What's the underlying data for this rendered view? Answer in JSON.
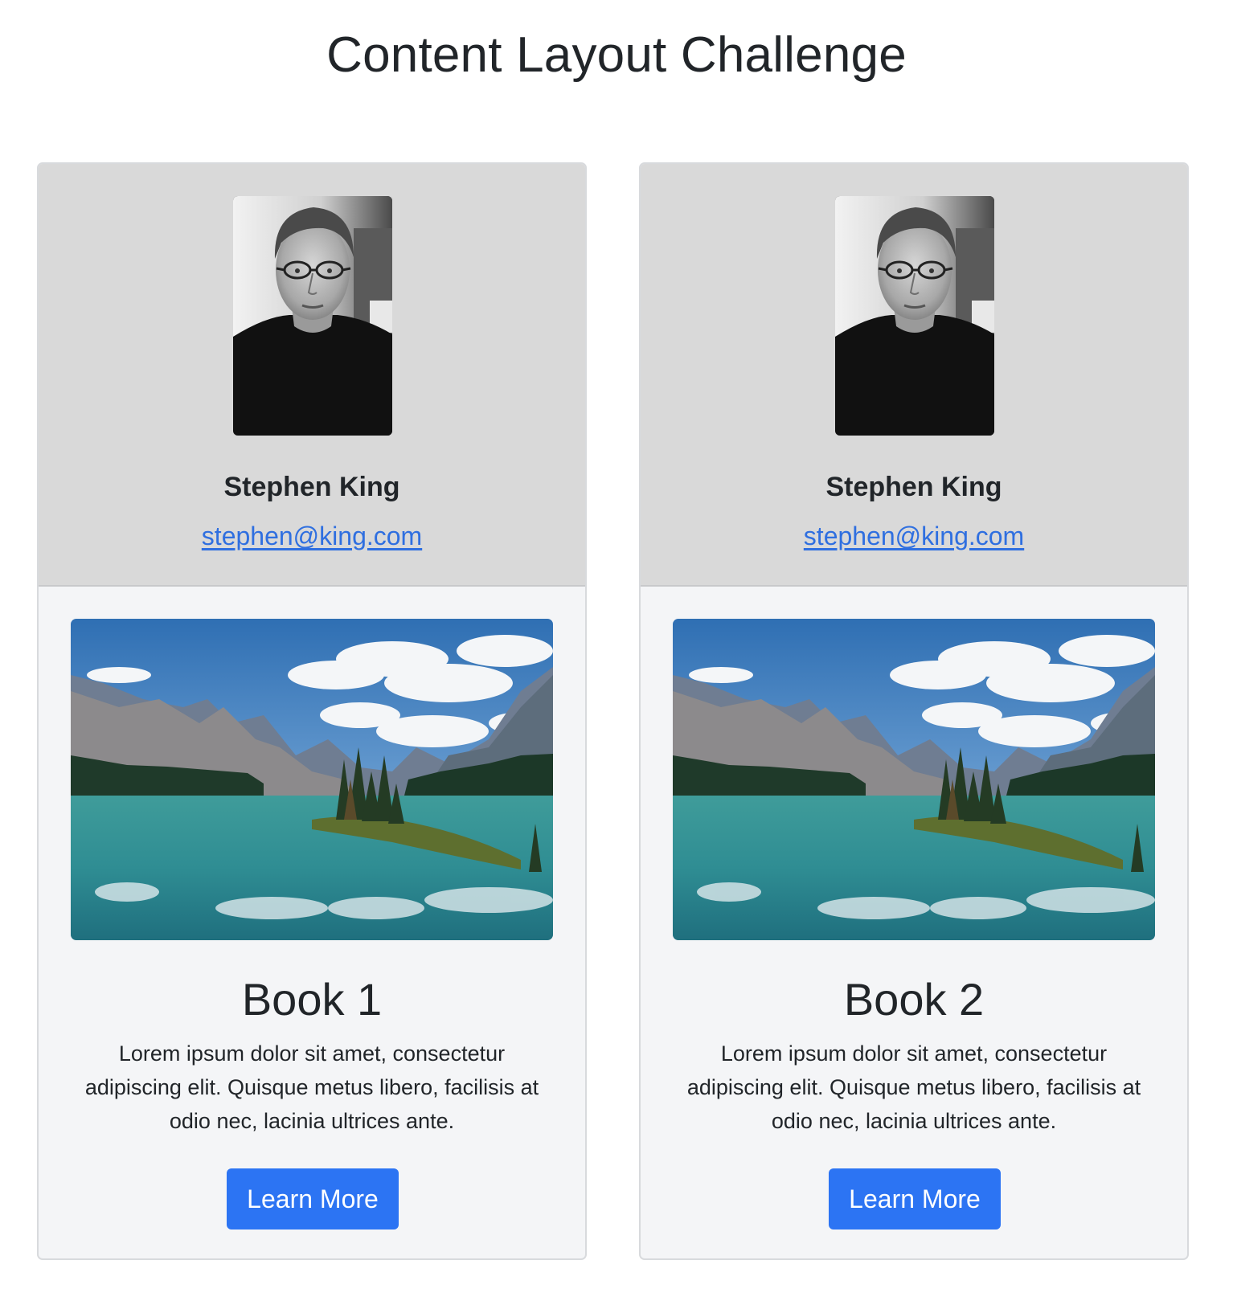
{
  "page": {
    "title": "Content Layout Challenge"
  },
  "cards": [
    {
      "author": {
        "name": "Stephen King",
        "email": "stephen@king.com"
      },
      "book": {
        "title": "Book 1",
        "description": "Lorem ipsum dolor sit amet, consectetur adipiscing elit. Quisque metus libero, facilisis at odio nec, lacinia ultrices ante.",
        "button_label": "Learn More"
      }
    },
    {
      "author": {
        "name": "Stephen King",
        "email": "stephen@king.com"
      },
      "book": {
        "title": "Book 2",
        "description": "Lorem ipsum dolor sit amet, consectetur adipiscing elit. Quisque metus libero, facilisis at odio nec, lacinia ultrices ante.",
        "button_label": "Learn More"
      }
    }
  ],
  "colors": {
    "accent": "#2c74f3",
    "link": "#2f6fe0",
    "header_bg": "#d9d9d9",
    "card_bg": "#f4f5f7"
  },
  "icons": {
    "author_photo": "portrait-photo",
    "book_image": "mountain-lake-photo"
  }
}
